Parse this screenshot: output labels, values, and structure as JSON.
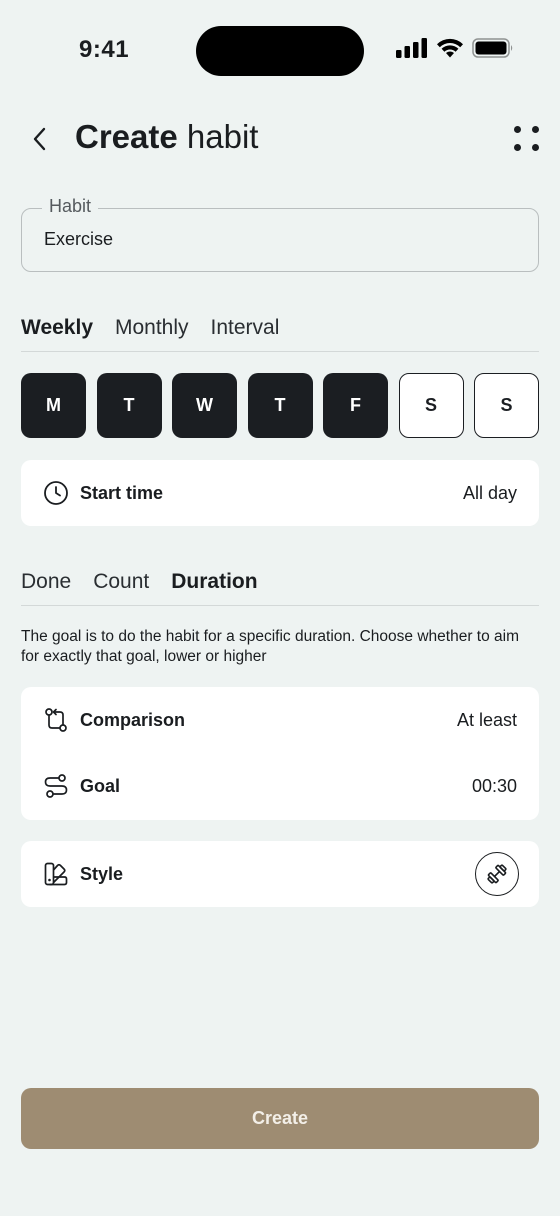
{
  "status_bar": {
    "time": "9:41"
  },
  "header": {
    "title_bold": "Create",
    "title_rest": " habit"
  },
  "habit_field": {
    "label": "Habit",
    "value": "Exercise"
  },
  "frequency_tabs": [
    "Weekly",
    "Monthly",
    "Interval"
  ],
  "frequency_active": "Weekly",
  "days": [
    {
      "label": "M",
      "selected": true
    },
    {
      "label": "T",
      "selected": true
    },
    {
      "label": "W",
      "selected": true
    },
    {
      "label": "T",
      "selected": true
    },
    {
      "label": "F",
      "selected": true
    },
    {
      "label": "S",
      "selected": false
    },
    {
      "label": "S",
      "selected": false
    }
  ],
  "start_time": {
    "icon": "clock-icon",
    "label": "Start time",
    "value": "All day"
  },
  "goal_tabs": [
    "Done",
    "Count",
    "Duration"
  ],
  "goal_active": "Duration",
  "description": "The goal is to do the habit for a specific duration. Choose whether to aim for exactly that goal, lower or higher",
  "goal_settings": {
    "comparison": {
      "icon": "comparison-icon",
      "label": "Comparison",
      "value": "At least"
    },
    "goal": {
      "icon": "route-icon",
      "label": "Goal",
      "value": "00:30"
    }
  },
  "style": {
    "icon": "palette-icon",
    "label": "Style",
    "selected_icon": "dumbbell-icon"
  },
  "create_button": {
    "label": "Create"
  },
  "colors": {
    "background": "#eef3f2",
    "dark": "#1b1e22",
    "create": "#9e8c72"
  }
}
